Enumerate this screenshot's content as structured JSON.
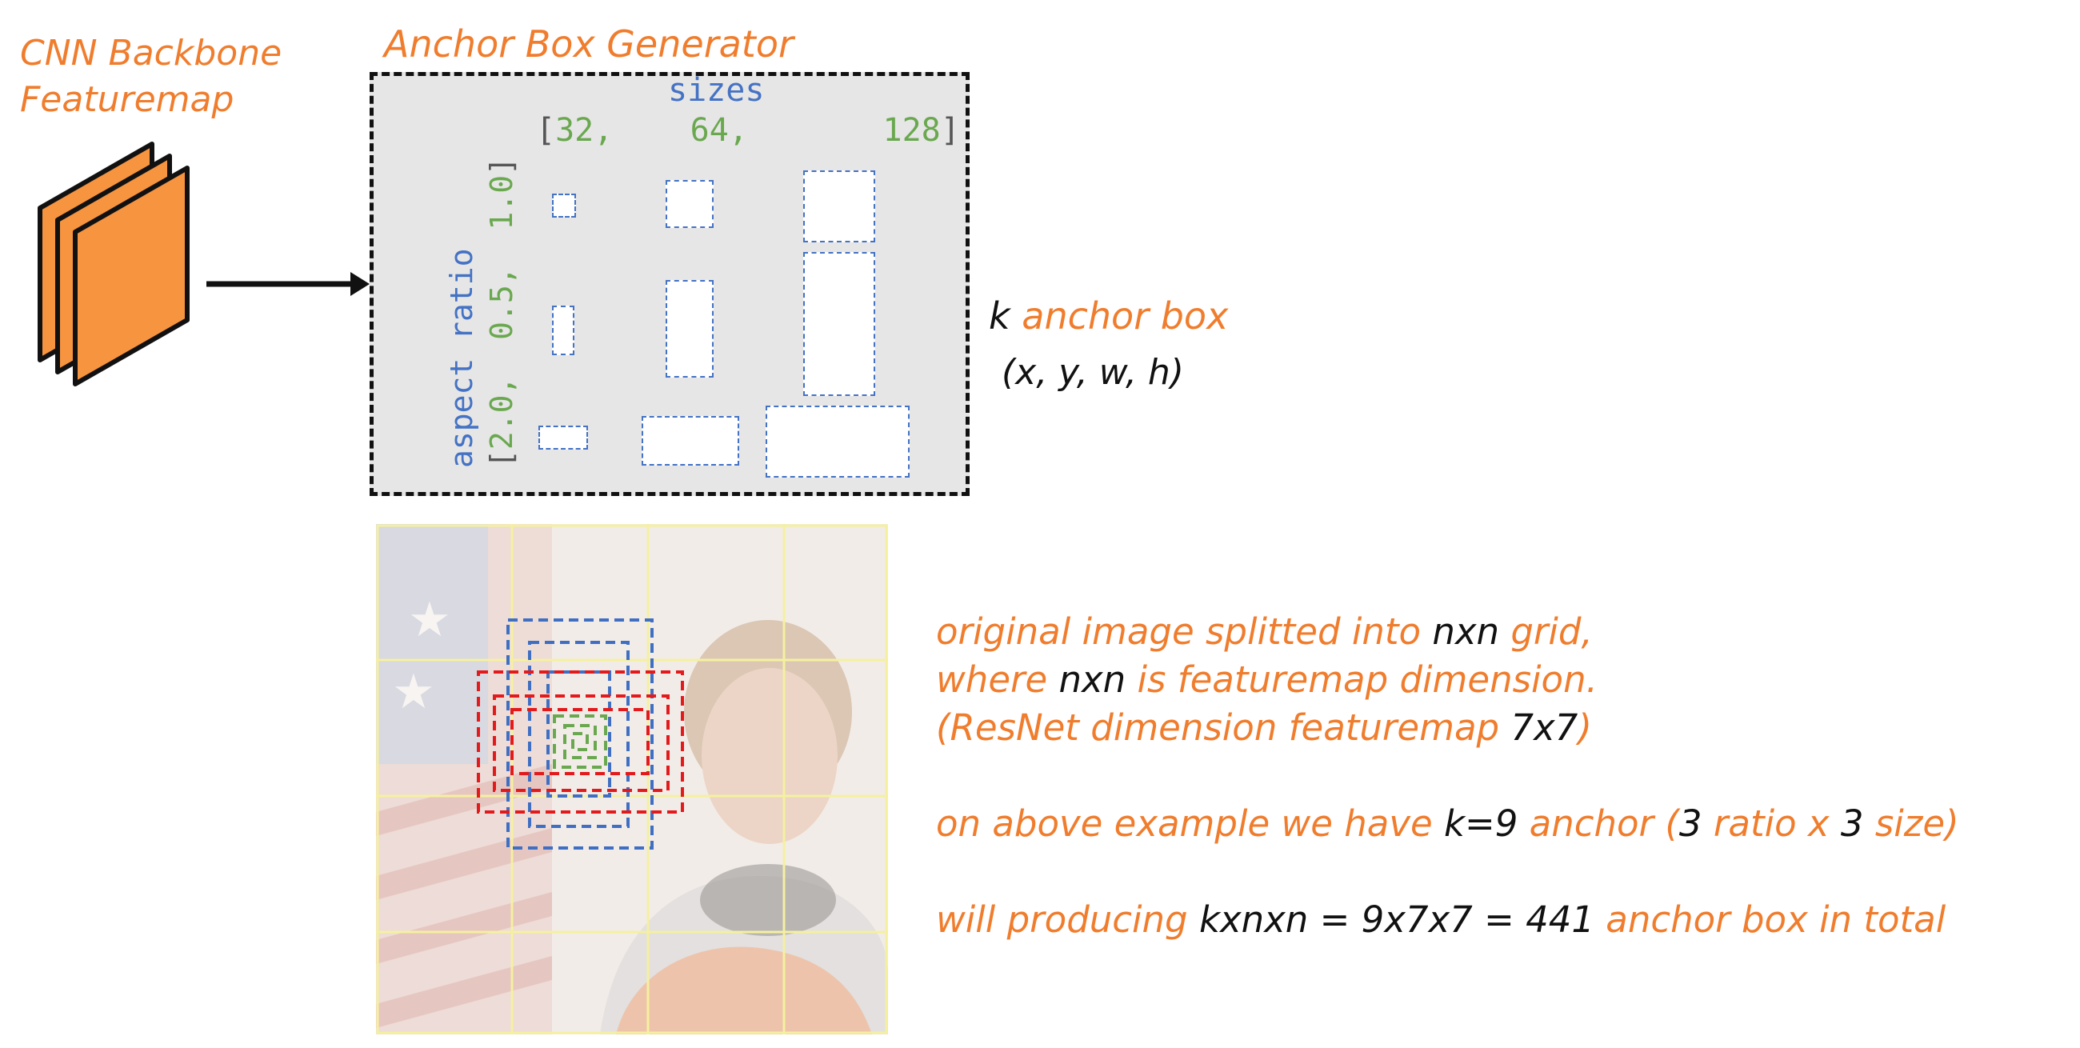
{
  "backbone": {
    "title_line1": "CNN Backbone",
    "title_line2": "Featuremap"
  },
  "generator": {
    "title": "Anchor Box Generator",
    "sizes_label": "sizes",
    "sizes_open": "[",
    "sizes": [
      "32,",
      "64,",
      "128"
    ],
    "sizes_close": "]",
    "ratio_label": "aspect ratio",
    "ratio_open": "[",
    "ratios": [
      "2.0,",
      "0.5,",
      "1.0"
    ],
    "ratio_close": "]"
  },
  "output": {
    "k": "k",
    "anchor_word": "anchor",
    "box_word": "box",
    "coords": "(x, y, w, h)"
  },
  "description": {
    "line1_a": "original image splitted into ",
    "line1_b": "nxn",
    "line1_c": " grid,",
    "line2_a": "where ",
    "line2_b": "nxn",
    "line2_c": " is featuremap dimension.",
    "line3_a": "(ResNet dimension featuremap ",
    "line3_b": "7x7",
    "line3_c": ")",
    "line4_a": "on above example we have ",
    "line4_b": "k=9",
    "line4_c": " anchor (",
    "line4_d": "3",
    "line4_e": " ratio x ",
    "line4_f": "3",
    "line4_g": " size)",
    "line5_a": "will producing ",
    "line5_b": "kxnxn = 9x7x7 = 441",
    "line5_c": " anchor box in total"
  },
  "colors": {
    "accent_orange": "#f07d2d",
    "sizes_blue": "#4472c4",
    "values_green": "#6aa84f",
    "anchor_red": "#e31a1c",
    "grid_yellow": "#f5f0a0"
  }
}
